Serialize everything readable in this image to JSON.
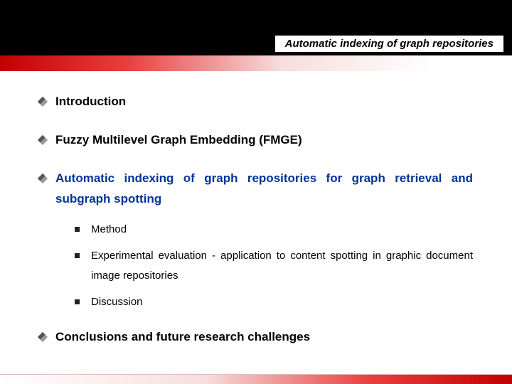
{
  "header": {
    "title": "Automatic indexing of graph repositories"
  },
  "outline": {
    "items": [
      {
        "text": "Introduction",
        "highlight": false,
        "sub": []
      },
      {
        "text": "Fuzzy Multilevel Graph Embedding (FMGE)",
        "highlight": false,
        "sub": []
      },
      {
        "text": "Automatic indexing of graph repositories for graph retrieval and subgraph spotting",
        "highlight": true,
        "sub": [
          "Method",
          "Experimental evaluation - application to content spotting in graphic document image repositories",
          "Discussion"
        ]
      },
      {
        "text": "Conclusions and future research challenges",
        "highlight": false,
        "sub": []
      }
    ]
  }
}
